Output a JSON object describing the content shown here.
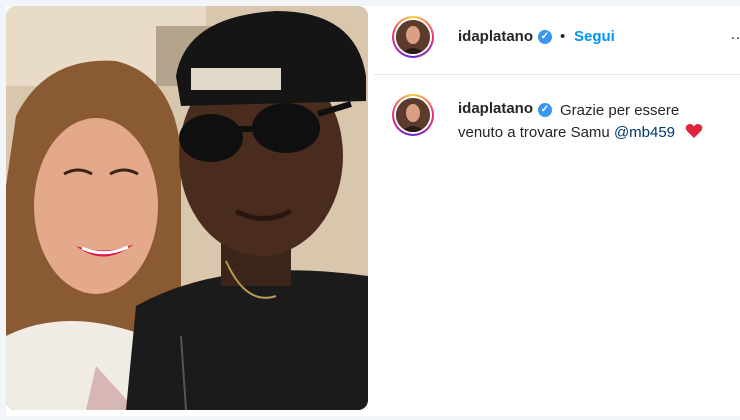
{
  "post": {
    "author": "idaplatano",
    "follow_label": "Segui",
    "separator": "•",
    "more_label": "…",
    "verified_glyph": "✓"
  },
  "comment": {
    "author": "idaplatano",
    "text": "Grazie per essere venuto a trovare Samu",
    "mention": "@mb459",
    "emoji": "red-heart-icon"
  },
  "colors": {
    "link_blue": "#0095f6",
    "verified_blue": "#3897f0",
    "text": "#262626",
    "heart_red": "#e0243b"
  }
}
